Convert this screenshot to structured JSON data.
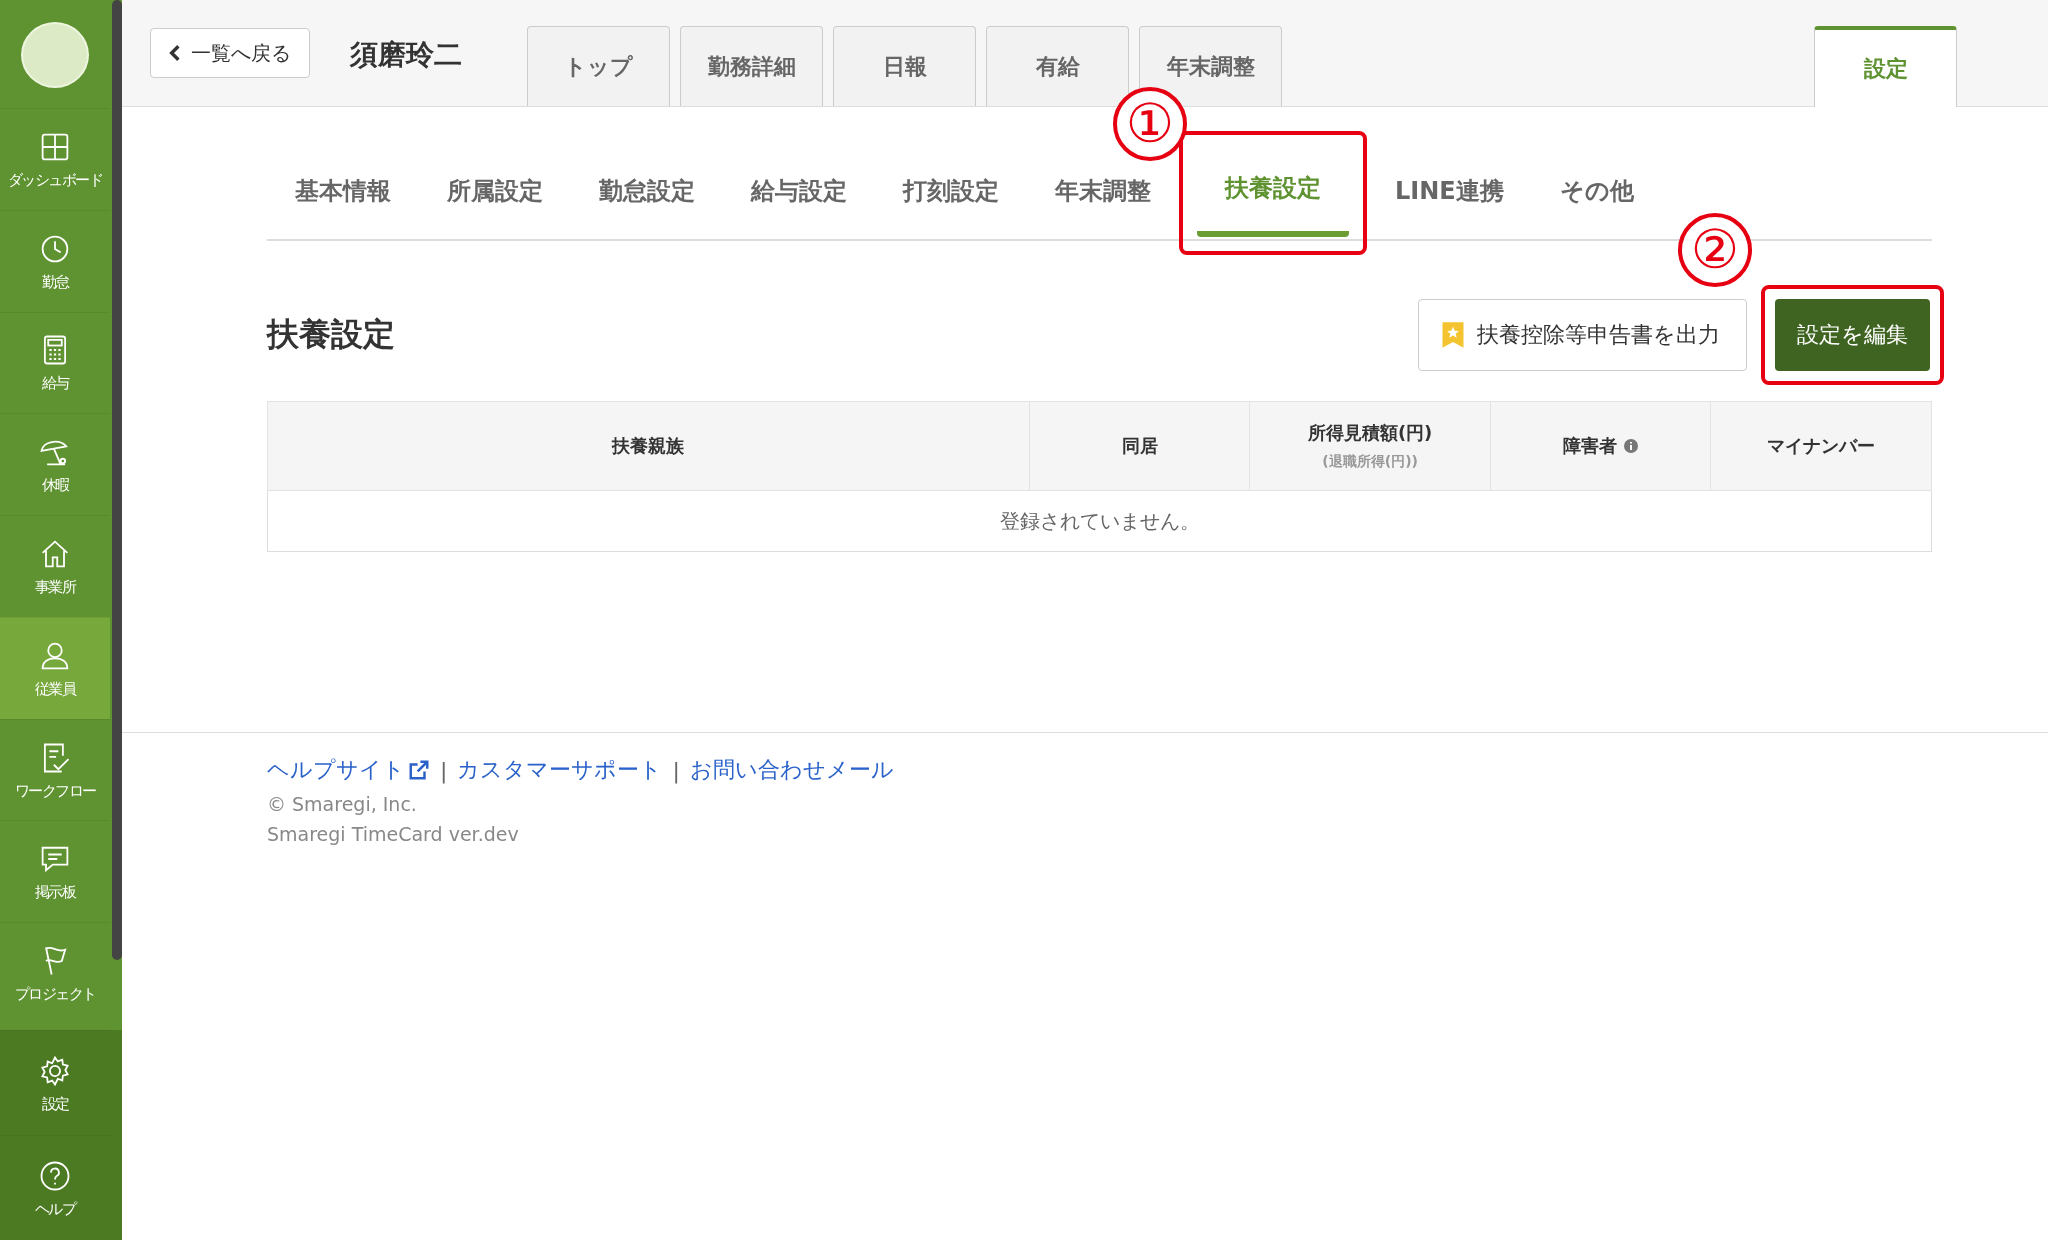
{
  "sidebar": {
    "items": [
      {
        "label": "ダッシュボード",
        "selected": false
      },
      {
        "label": "勤怠",
        "selected": false
      },
      {
        "label": "給与",
        "selected": false
      },
      {
        "label": "休暇",
        "selected": false
      },
      {
        "label": "事業所",
        "selected": false
      },
      {
        "label": "従業員",
        "selected": true
      },
      {
        "label": "ワークフロー",
        "selected": false
      },
      {
        "label": "掲示板",
        "selected": false
      },
      {
        "label": "プロジェクト",
        "selected": false
      }
    ],
    "bottom_items": [
      {
        "label": "設定"
      },
      {
        "label": "ヘルプ"
      }
    ]
  },
  "header": {
    "back_button": "一覧へ戻る",
    "employee_name": "須磨玲二",
    "tabs": [
      {
        "label": "トップ",
        "selected": false
      },
      {
        "label": "勤務詳細",
        "selected": false
      },
      {
        "label": "日報",
        "selected": false
      },
      {
        "label": "有給",
        "selected": false
      },
      {
        "label": "年末調整",
        "selected": false
      },
      {
        "label": "設定",
        "selected": true
      }
    ]
  },
  "subtabs": [
    {
      "label": "基本情報",
      "selected": false
    },
    {
      "label": "所属設定",
      "selected": false
    },
    {
      "label": "勤怠設定",
      "selected": false
    },
    {
      "label": "給与設定",
      "selected": false
    },
    {
      "label": "打刻設定",
      "selected": false
    },
    {
      "label": "年末調整",
      "selected": false
    },
    {
      "label": "扶養設定",
      "selected": true
    },
    {
      "label": "LINE連携",
      "selected": false
    },
    {
      "label": "その他",
      "selected": false
    }
  ],
  "section": {
    "title": "扶養設定",
    "export_button": "扶養控除等申告書を出力",
    "edit_button": "設定を編集"
  },
  "table": {
    "columns": [
      {
        "label": "扶養親族"
      },
      {
        "label": "同居"
      },
      {
        "label": "所得見積額(円)",
        "sublabel": "(退職所得(円))"
      },
      {
        "label": "障害者",
        "info": true
      },
      {
        "label": "マイナンバー"
      }
    ],
    "empty_message": "登録されていません。"
  },
  "footer": {
    "links": [
      {
        "kind": "link",
        "text": "ヘルプサイト",
        "external": true
      },
      {
        "kind": "separator",
        "text": "|"
      },
      {
        "kind": "link",
        "text": "カスタマーサポート"
      },
      {
        "kind": "separator",
        "text": "|"
      },
      {
        "kind": "link",
        "text": "お問い合わせメール"
      }
    ],
    "copyright": "© Smaregi, Inc.",
    "version": "Smaregi TimeCard ver.dev"
  },
  "annotations": [
    {
      "kind": "tab",
      "number": "①"
    },
    {
      "kind": "button",
      "number": "②"
    }
  ]
}
